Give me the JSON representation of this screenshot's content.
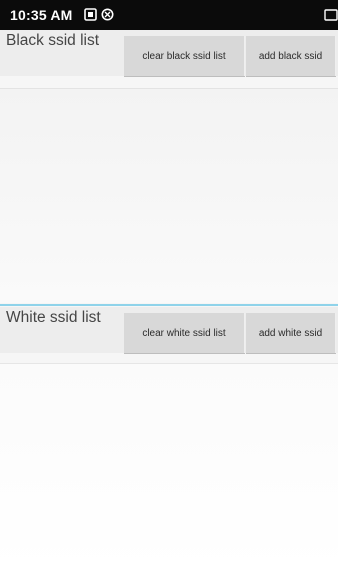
{
  "status_bar": {
    "time": "10:35 AM",
    "icons": [
      "media-icon",
      "sync-icon",
      "notification-icon"
    ]
  },
  "black_section": {
    "title": "Black ssid list",
    "clear_label": "clear black ssid list",
    "add_label": "add black ssid",
    "items": []
  },
  "white_section": {
    "title": "White ssid list",
    "clear_label": "clear white ssid list",
    "add_label": "add white ssid",
    "items": []
  },
  "colors": {
    "status_bar": "#0b0b0b",
    "button": "#d8d8d8",
    "divider": "#8fd3ea"
  }
}
